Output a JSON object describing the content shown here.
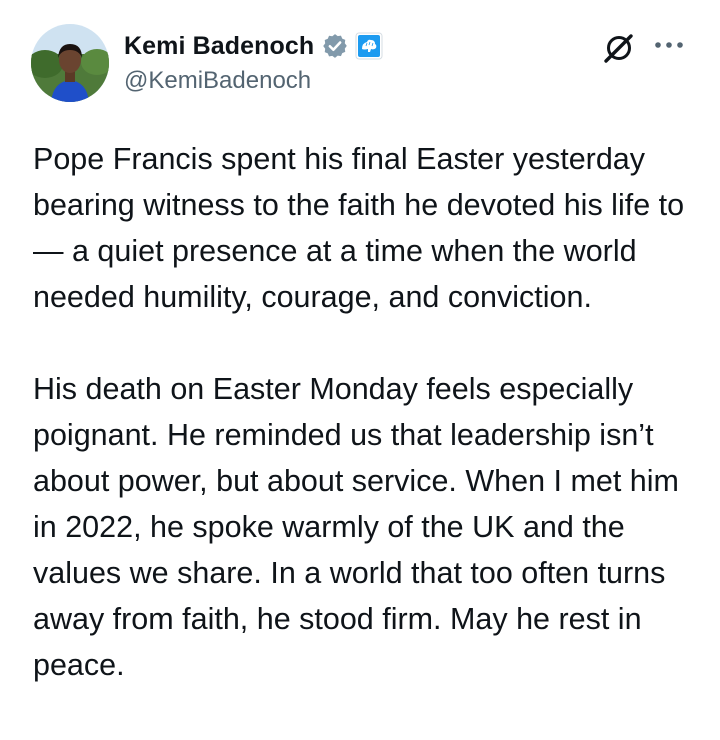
{
  "author": {
    "display_name": "Kemi Badenoch",
    "handle": "@KemiBadenoch",
    "avatar_icon": "profile-photo",
    "verified_icon": "verified-badge-icon",
    "affiliation_icon": "conservative-party-badge-icon",
    "colors": {
      "verified": "#829aab",
      "affiliation": "#1d9bf0"
    }
  },
  "header_actions": {
    "grok_icon": "grok-icon",
    "more_icon": "more-options-icon"
  },
  "tweet": {
    "paragraphs": [
      "Pope Francis spent his final Easter yesterday bearing witness to the faith he devoted his life to — a quiet presence at a time when the world needed humility, courage, and conviction.",
      "His death on Easter Monday feels especially poignant. He reminded us that leadership isn’t about power, but about service. When I met him in 2022, he spoke warmly of the UK and the values we share. In a world that too often turns away from faith, he stood firm. May he rest in peace."
    ]
  }
}
